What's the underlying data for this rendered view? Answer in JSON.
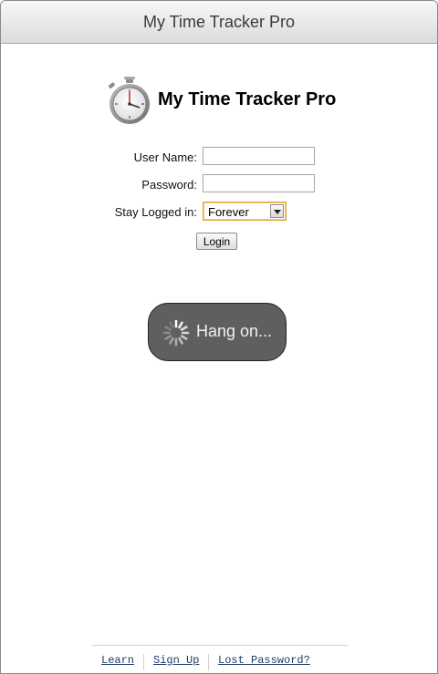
{
  "window": {
    "title": "My Time Tracker Pro"
  },
  "brand": {
    "name": "My Time Tracker Pro",
    "icon": "stopwatch-icon"
  },
  "form": {
    "username_label": "User Name:",
    "username_value": "",
    "password_label": "Password:",
    "password_value": "",
    "stay_label": "Stay Logged in:",
    "stay_selected": "Forever",
    "login_label": "Login"
  },
  "loader": {
    "text": "Hang on...",
    "icon": "spinner-icon"
  },
  "footer": {
    "links": [
      "Learn",
      "Sign Up",
      "Lost Password?"
    ]
  },
  "colors": {
    "titlebar_text": "#3a3a3a",
    "loader_bg": "#5f5f5f",
    "link": "#1f3a66",
    "select_focus": "#e0a437"
  }
}
